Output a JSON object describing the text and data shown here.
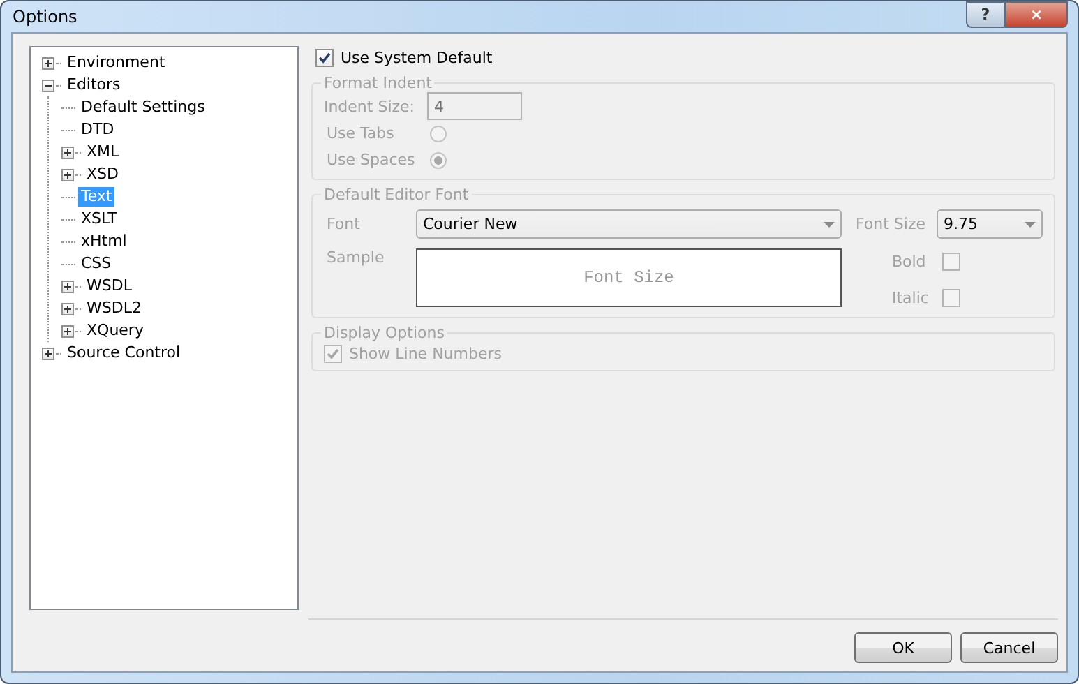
{
  "window": {
    "title": "Options",
    "help": "?",
    "close": "×"
  },
  "tree": [
    {
      "label": "Environment",
      "expanded": false,
      "selected": false
    },
    {
      "label": "Editors",
      "expanded": true,
      "selected": false,
      "children": [
        {
          "label": "Default Settings",
          "selected": false
        },
        {
          "label": "DTD",
          "selected": false
        },
        {
          "label": "XML",
          "expanded": false,
          "selected": false
        },
        {
          "label": "XSD",
          "expanded": false,
          "selected": false
        },
        {
          "label": "Text",
          "selected": true
        },
        {
          "label": "XSLT",
          "selected": false
        },
        {
          "label": "xHtml",
          "selected": false
        },
        {
          "label": "CSS",
          "selected": false
        },
        {
          "label": "WSDL",
          "expanded": false,
          "selected": false
        },
        {
          "label": "WSDL2",
          "expanded": false,
          "selected": false
        },
        {
          "label": "XQuery",
          "expanded": false,
          "selected": false
        }
      ]
    },
    {
      "label": "Source Control",
      "expanded": false,
      "selected": false
    }
  ],
  "use_system_default": {
    "label": "Use System Default",
    "checked": true
  },
  "format_indent": {
    "title": "Format Indent",
    "disabled": true,
    "indent_size_label": "Indent Size:",
    "indent_size": "4",
    "options": [
      {
        "label": "Use Tabs",
        "selected": false
      },
      {
        "label": "Use Spaces",
        "selected": true
      }
    ]
  },
  "default_editor_font": {
    "title": "Default Editor Font",
    "disabled": true,
    "font_label": "Font",
    "font": "Courier New",
    "font_size_label": "Font Size",
    "font_size": "9.75",
    "sample_label": "Sample",
    "sample": "Font Size",
    "bold": {
      "label": "Bold",
      "checked": false
    },
    "italic": {
      "label": "Italic",
      "checked": false
    }
  },
  "display_options": {
    "title": "Display Options",
    "disabled": true,
    "show_line_numbers": {
      "label": "Show Line Numbers",
      "checked": true
    }
  },
  "buttons": [
    "OK",
    "Cancel"
  ]
}
